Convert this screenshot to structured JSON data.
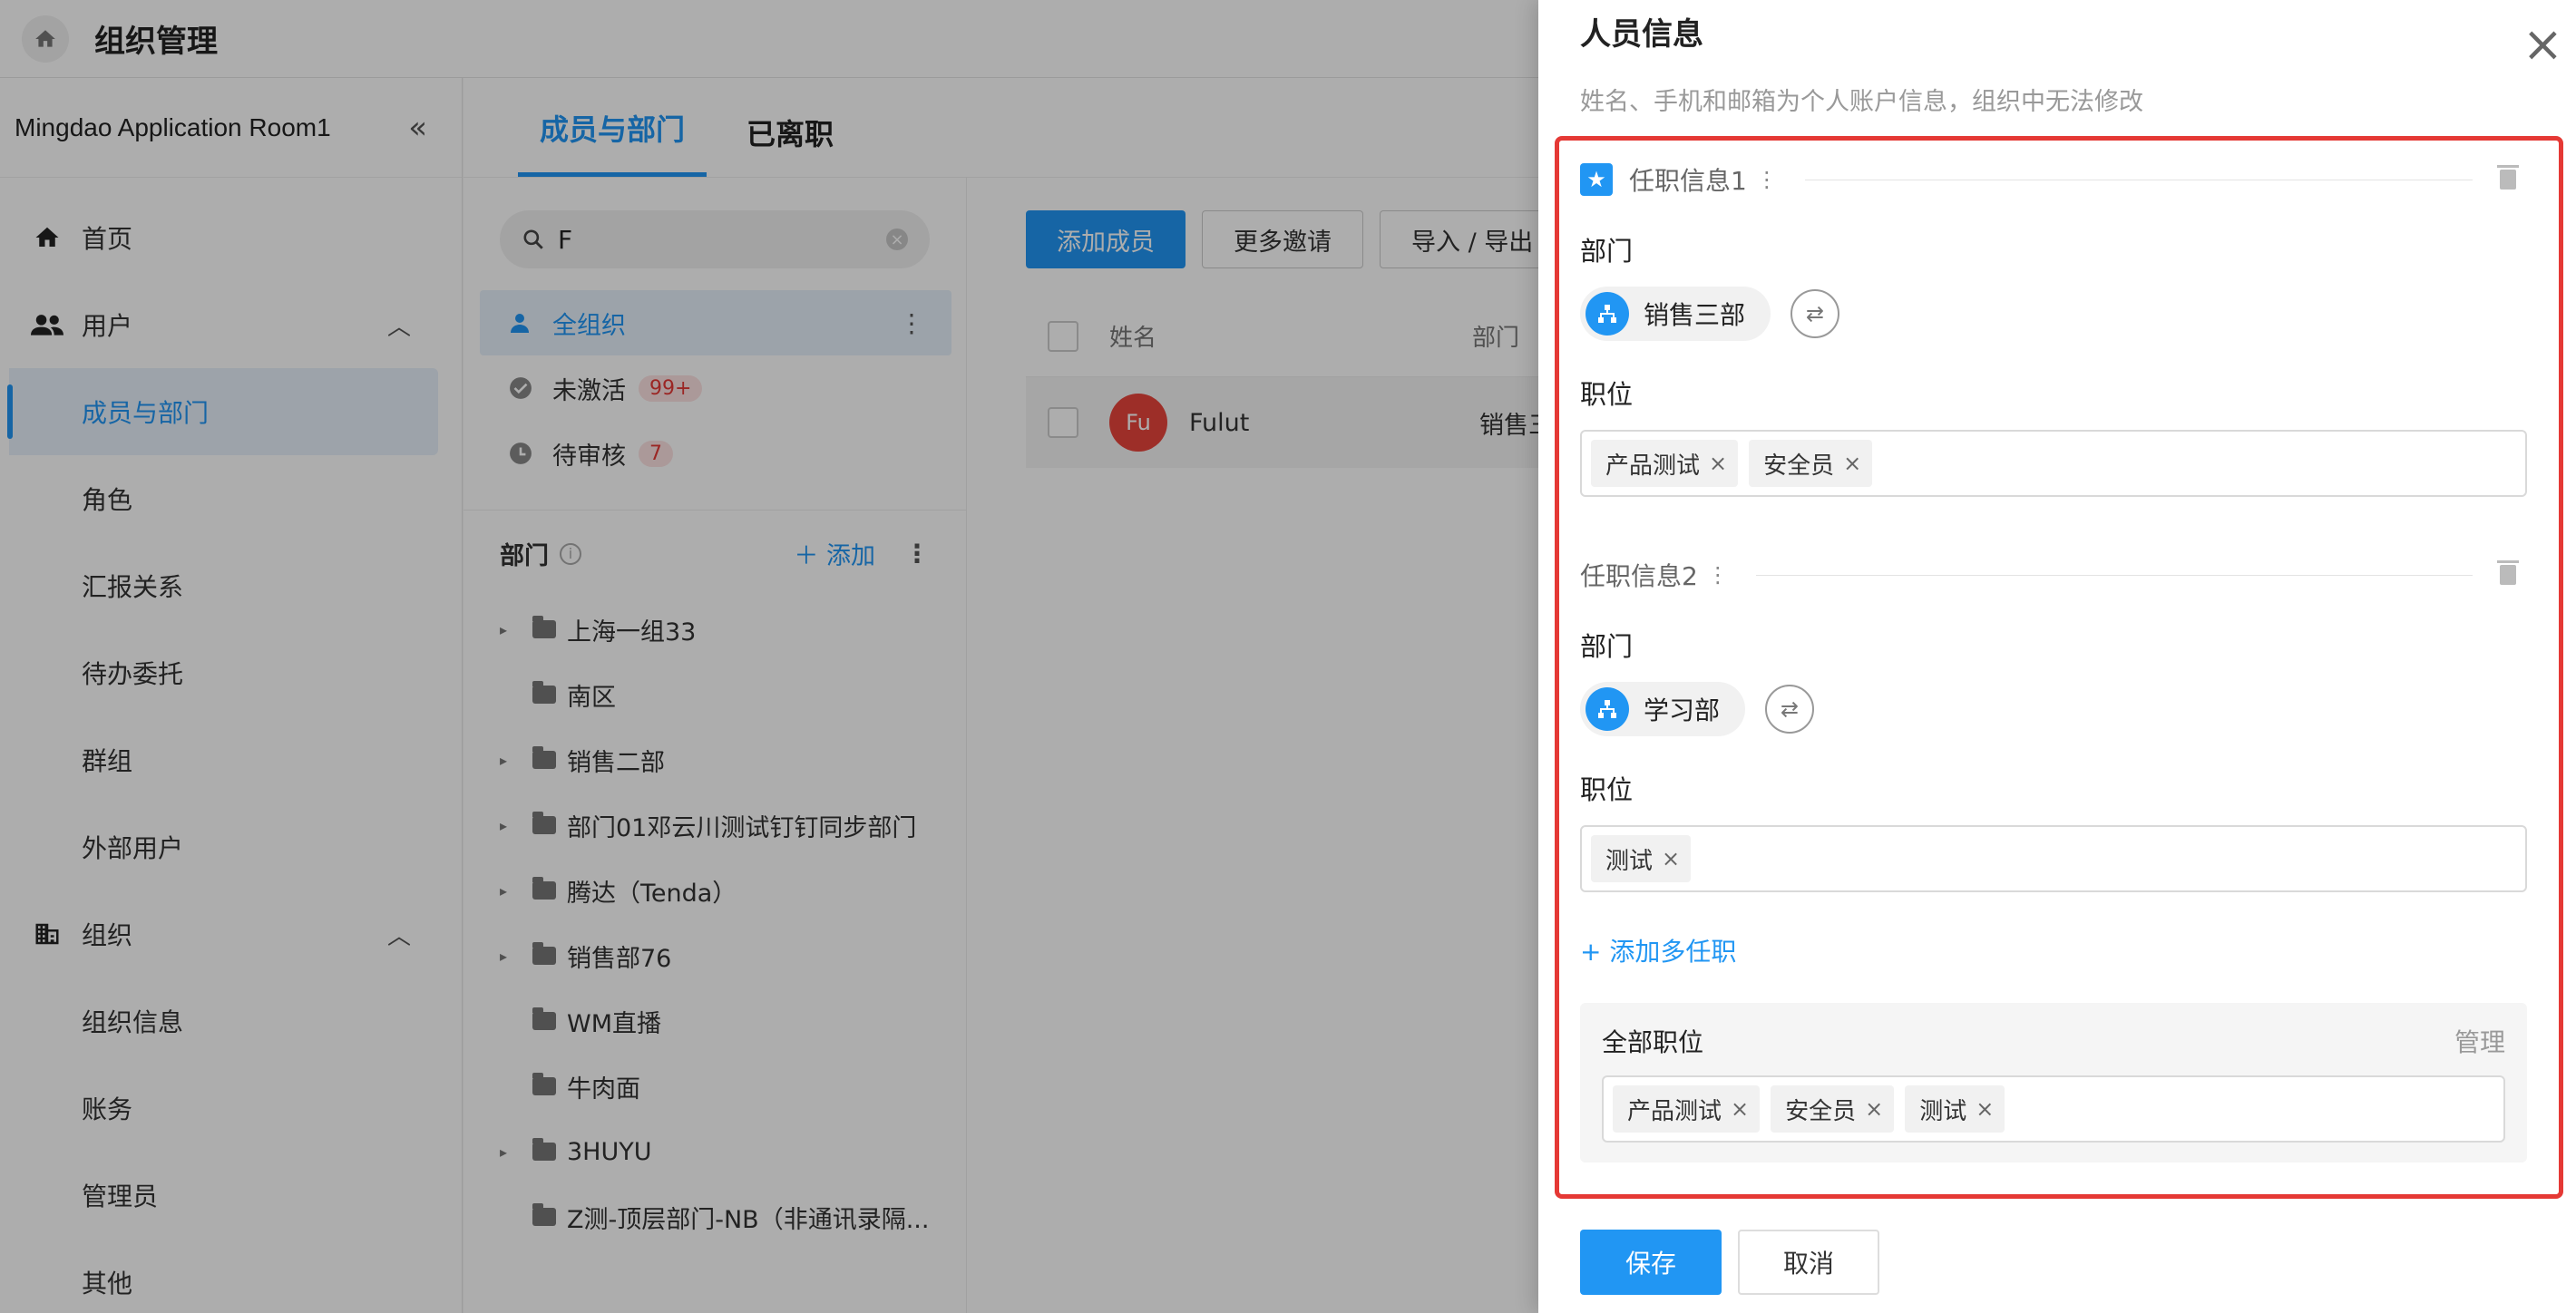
{
  "header": {
    "title": "组织管理"
  },
  "sidebar": {
    "org_name": "Mingdao Application Room1",
    "home": "首页",
    "users_group": "用户",
    "users_items": [
      "成员与部门",
      "角色",
      "汇报关系",
      "待办委托",
      "群组",
      "外部用户"
    ],
    "org_group": "组织",
    "org_items": [
      "组织信息",
      "账务",
      "管理员",
      "其他"
    ]
  },
  "tabs": [
    "成员与部门",
    "已离职"
  ],
  "search": {
    "value": "F"
  },
  "filters": {
    "all_org": "全组织",
    "inactive": "未激活",
    "inactive_count": "99+",
    "pending": "待审核",
    "pending_count": "7"
  },
  "departments": {
    "heading": "部门",
    "add_label": "添加",
    "items": [
      {
        "name": "上海一组33",
        "expandable": true
      },
      {
        "name": "南区",
        "expandable": false
      },
      {
        "name": "销售二部",
        "expandable": true
      },
      {
        "name": "部门01邓云川测试钉钉同步部门",
        "expandable": true
      },
      {
        "name": "腾达（Tenda）",
        "expandable": true
      },
      {
        "name": "销售部76",
        "expandable": true
      },
      {
        "name": "WM直播",
        "expandable": false
      },
      {
        "name": "牛肉面",
        "expandable": false
      },
      {
        "name": "3HUYU",
        "expandable": true
      },
      {
        "name": "Z测-顶层部门-NB（非通讯录隔...",
        "expandable": false
      }
    ]
  },
  "toolbar": {
    "add_member": "添加成员",
    "more_invite": "更多邀请",
    "import_export": "导入 / 导出"
  },
  "table": {
    "col_name": "姓名",
    "col_dept": "部门",
    "rows": [
      {
        "avatar": "Fu",
        "name": "Fulut",
        "dept": "销售三"
      }
    ]
  },
  "drawer": {
    "title": "人员信息",
    "subtitle": "姓名、手机和邮箱为个人账户信息，组织中无法修改",
    "job1": {
      "title": "任职信息1",
      "dept_label": "部门",
      "dept": "销售三部",
      "pos_label": "职位",
      "positions": [
        "产品测试",
        "安全员"
      ]
    },
    "job2": {
      "title": "任职信息2",
      "dept_label": "部门",
      "dept": "学习部",
      "pos_label": "职位",
      "positions": [
        "测试"
      ]
    },
    "add_more": "+ 添加多任职",
    "all_positions_label": "全部职位",
    "manage": "管理",
    "all_positions": [
      "产品测试",
      "安全员",
      "测试"
    ],
    "save": "保存",
    "cancel": "取消"
  },
  "colors": {
    "accent": "#2196f3",
    "highlight": "#e53935"
  }
}
